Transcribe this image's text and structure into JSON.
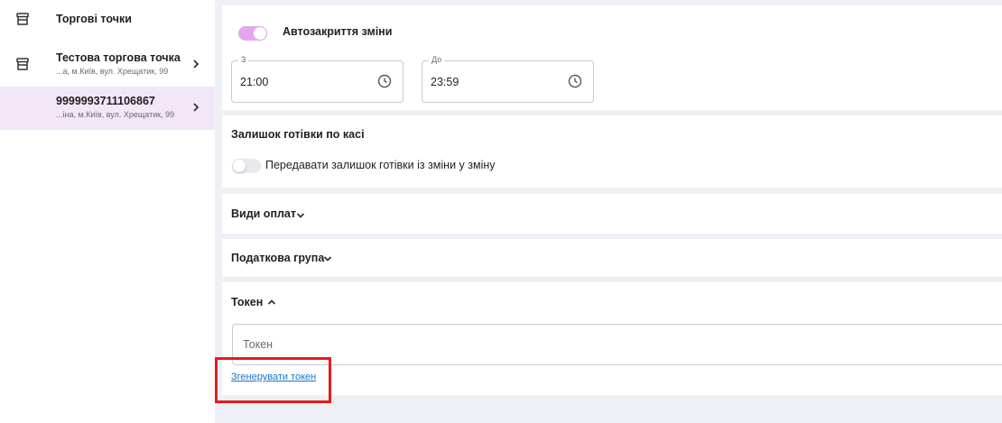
{
  "sidebar": {
    "header": {
      "title": "Торгові точки",
      "icon": "store-icon"
    },
    "items": [
      {
        "title": "Тестова торгова точка",
        "subtitle": "...а, м.Київ, вул. Хрещатик, 99",
        "icon": "store-icon",
        "selected": false
      },
      {
        "title": "9999993711106867",
        "subtitle": "...іна, м.Київ, вул. Хрещатик, 99",
        "selected": true
      }
    ]
  },
  "auto_close": {
    "toggle_label": "Автозакриття зміни",
    "enabled": true,
    "from": {
      "label": "З",
      "value": "21:00"
    },
    "to": {
      "label": "До",
      "value": "23:59"
    }
  },
  "cash_balance": {
    "title": "Залишок готівки по касі",
    "toggle_label": "Передавати залишок готівки із зміни у зміну",
    "enabled": false
  },
  "payment_types": {
    "title": "Види оплат",
    "expanded": false
  },
  "tax_group": {
    "title": "Податкова група",
    "expanded": false
  },
  "token": {
    "title": "Токен",
    "expanded": true,
    "input_placeholder": "Токен",
    "input_value": "",
    "generate_link": "Згенерувати токен"
  },
  "colors": {
    "accent_pink": "#e6a6ee",
    "selected_row": "#f3e6f7",
    "link": "#1a73c8",
    "highlight_red": "#e51c1c",
    "page_bg": "#eef0f5"
  }
}
